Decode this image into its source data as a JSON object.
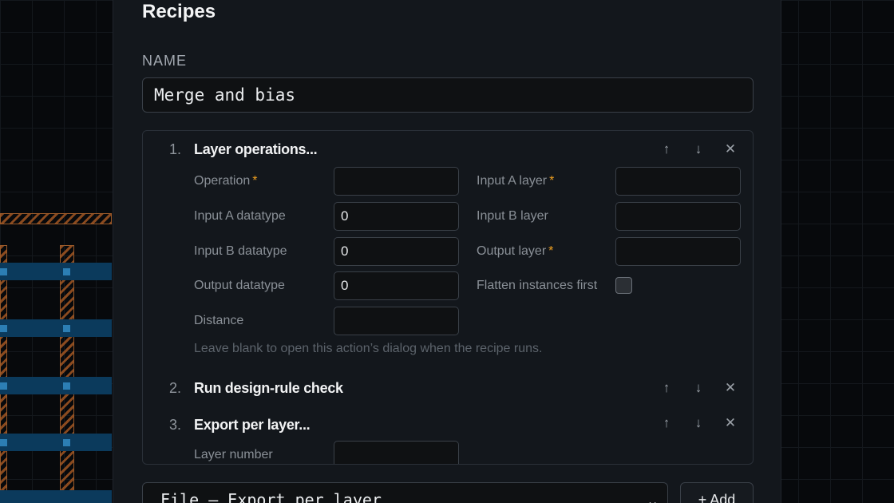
{
  "dialog": {
    "title": "Recipes",
    "name_label": "NAME",
    "name_value": "Merge and bias"
  },
  "steps": [
    {
      "number": "1.",
      "title": "Layer operations...",
      "fields": [
        {
          "label": "Operation",
          "required": "*",
          "value": ""
        },
        {
          "label": "Input A layer",
          "required": "*",
          "value": ""
        },
        {
          "label": "Input A datatype",
          "value": "0"
        },
        {
          "label": "Input B layer",
          "value": ""
        },
        {
          "label": "Input B datatype",
          "value": "0"
        },
        {
          "label": "Output layer",
          "required": "*",
          "value": ""
        },
        {
          "label": "Output datatype",
          "value": "0"
        },
        {
          "label": "Flatten instances first",
          "checked": false
        },
        {
          "label": "Distance",
          "value": ""
        }
      ],
      "hint": "Leave blank to open this action’s dialog when the recipe runs."
    },
    {
      "number": "2.",
      "title": "Run design-rule check"
    },
    {
      "number": "3.",
      "title": "Export per layer...",
      "fields": [
        {
          "label": "Layer number",
          "value": ""
        }
      ]
    }
  ],
  "controls": {
    "up": "↑",
    "down": "↓",
    "remove": "✕"
  },
  "footer": {
    "action_select_value": "File — Export per layer",
    "chevron": "⌄",
    "add_label": "+ Add"
  }
}
